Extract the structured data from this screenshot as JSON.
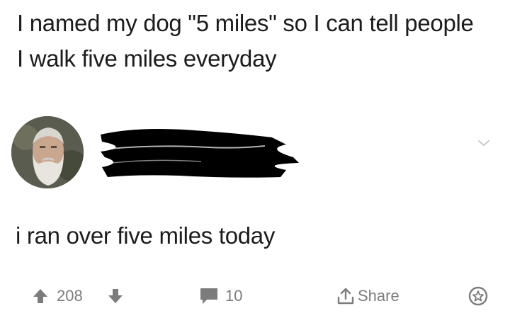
{
  "post": {
    "title": "I named my dog \"5 miles\" so I can tell people I walk five miles everyday"
  },
  "comment": {
    "text": "i ran over five miles today",
    "actions": {
      "score": "208",
      "reply_count": "10",
      "share_label": "Share"
    }
  },
  "icons": {
    "upvote": "arrow-up-icon",
    "downvote": "arrow-down-icon",
    "reply": "speech-bubble-icon",
    "share": "share-icon",
    "award": "award-icon",
    "more": "chevron-down-icon"
  },
  "colors": {
    "text": "#1c1c1c",
    "muted": "#7c7c7c",
    "redaction": "#000000"
  }
}
